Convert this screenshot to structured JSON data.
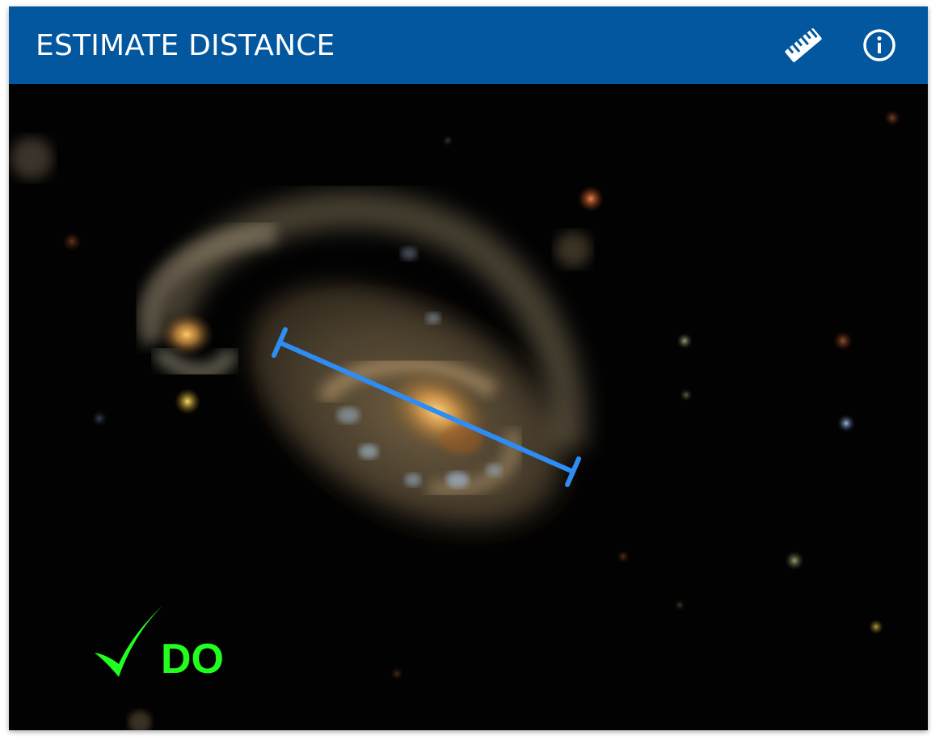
{
  "header": {
    "title": "ESTIMATE DISTANCE",
    "background": "#02579E",
    "icons": [
      "ruler-icon",
      "info-icon"
    ]
  },
  "image": {
    "subject": "spiral galaxy",
    "background": "#020202",
    "measure_line_color": "#2E8DF5"
  },
  "example": {
    "label": "DO",
    "color": "#22FF1E",
    "icon": "checkmark-icon"
  }
}
